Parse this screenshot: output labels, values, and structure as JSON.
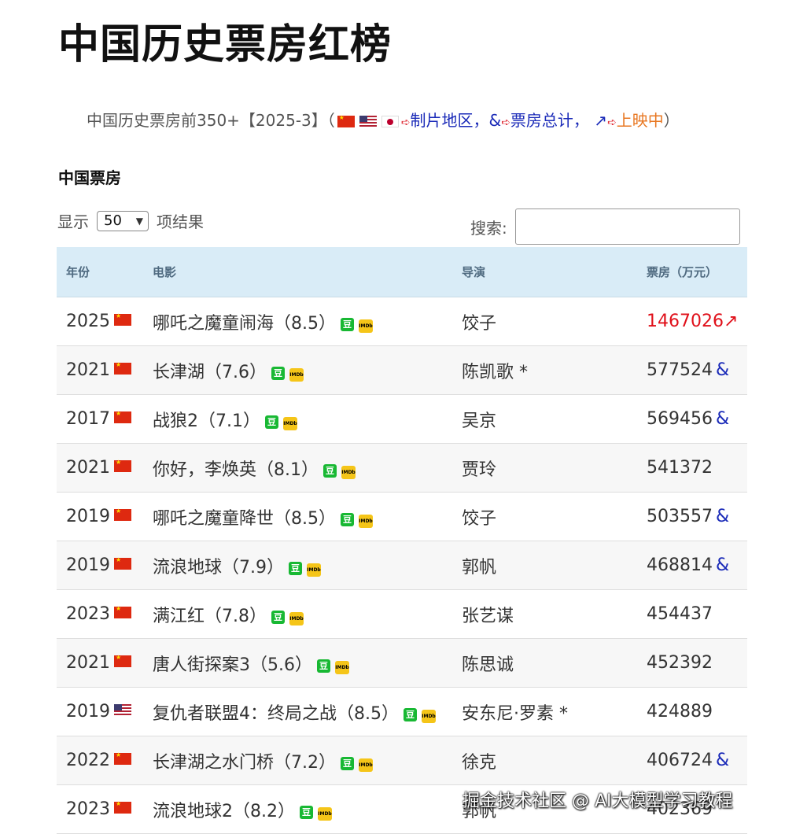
{
  "page_title": "中国历史票房红榜",
  "intro": {
    "prefix": "中国历史票房前350+【2025-3】（",
    "region_label": "制片地区，",
    "total_symbol": "&",
    "total_label": "票房总计，",
    "showing_symbol": "↗",
    "showing_label": "上映中",
    "suffix": "）"
  },
  "section_title": "中国票房",
  "length_control": {
    "prefix": "显示",
    "value": "50",
    "suffix": "项结果"
  },
  "search": {
    "label": "搜索:",
    "value": ""
  },
  "table": {
    "headers": {
      "year": "年份",
      "film": "电影",
      "director": "导演",
      "box_office": "票房（万元）"
    },
    "rows": [
      {
        "year": "2025",
        "flag": "cn",
        "film": "哪吒之魔童闹海（8.5）",
        "director": "饺子",
        "box_office": "1467026",
        "mark": "↗",
        "rising": true
      },
      {
        "year": "2021",
        "flag": "cn",
        "film": "长津湖（7.6）",
        "director": "陈凯歌 *",
        "box_office": "577524",
        "mark": "&",
        "rising": false
      },
      {
        "year": "2017",
        "flag": "cn",
        "film": "战狼2（7.1）",
        "director": "吴京",
        "box_office": "569456",
        "mark": "&",
        "rising": false
      },
      {
        "year": "2021",
        "flag": "cn",
        "film": "你好，李焕英（8.1）",
        "director": "贾玲",
        "box_office": "541372",
        "mark": "",
        "rising": false
      },
      {
        "year": "2019",
        "flag": "cn",
        "film": "哪吒之魔童降世（8.5）",
        "director": "饺子",
        "box_office": "503557",
        "mark": "&",
        "rising": false
      },
      {
        "year": "2019",
        "flag": "cn",
        "film": "流浪地球（7.9）",
        "director": "郭帆",
        "box_office": "468814",
        "mark": "&",
        "rising": false
      },
      {
        "year": "2023",
        "flag": "cn",
        "film": "满江红（7.8）",
        "director": "张艺谋",
        "box_office": "454437",
        "mark": "",
        "rising": false
      },
      {
        "year": "2021",
        "flag": "cn",
        "film": "唐人街探案3（5.6）",
        "director": "陈思诚",
        "box_office": "452392",
        "mark": "",
        "rising": false
      },
      {
        "year": "2019",
        "flag": "us",
        "film": "复仇者联盟4：终局之战（8.5）",
        "director": "安东尼·罗素 *",
        "box_office": "424889",
        "mark": "",
        "rising": false
      },
      {
        "year": "2022",
        "flag": "cn",
        "film": "长津湖之水门桥（7.2）",
        "director": "徐克",
        "box_office": "406724",
        "mark": "&",
        "rising": false
      },
      {
        "year": "2023",
        "flag": "cn",
        "film": "流浪地球2（8.2）",
        "director": "郭帆",
        "box_office": "402369",
        "mark": "",
        "rising": false
      }
    ]
  },
  "badges": {
    "douban": "豆",
    "imdb": "IMDb"
  },
  "watermark": "掘金技术社区 @ AI大模型学习教程"
}
